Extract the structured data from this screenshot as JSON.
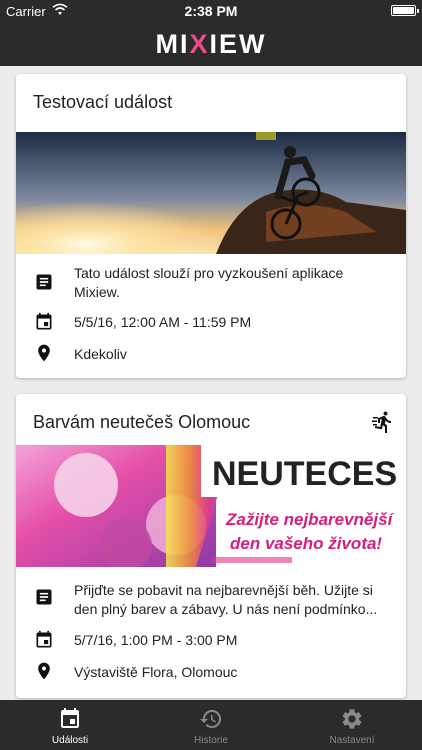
{
  "status_bar": {
    "carrier": "Carrier",
    "time": "2:38 PM"
  },
  "app": {
    "logo_left": "MI",
    "logo_x": "X",
    "logo_right": "IEW"
  },
  "events": [
    {
      "title": "Testovací událost",
      "description": "Tato událost slouží pro vyzkoušení aplikace Mixiew.",
      "datetime": "5/5/16, 12:00 AM - 11:59 PM",
      "location": "Kdekoliv"
    },
    {
      "title": "Barvám neutečeš Olomouc",
      "description": "Přijďte se pobavit na nejbarevnější běh. Užijte si den plný barev a zábavy. U nás není podmínko...",
      "datetime": "5/7/16, 1:00 PM - 3:00 PM",
      "location": "Výstaviště Flora, Olomouc",
      "banner_text_1": "NEUTECES",
      "banner_text_2": "Zažijte nejbarevnější",
      "banner_text_3": "den vašeho života!"
    }
  ],
  "tabs": [
    {
      "label": "Události",
      "icon": "calendar-icon",
      "active": true
    },
    {
      "label": "Historie",
      "icon": "history-icon",
      "active": false
    },
    {
      "label": "Nastavení",
      "icon": "gear-icon",
      "active": false
    }
  ],
  "colors": {
    "bar": "#2b2b2b",
    "logo_accent": "#f04a8a",
    "background": "#ececec"
  }
}
